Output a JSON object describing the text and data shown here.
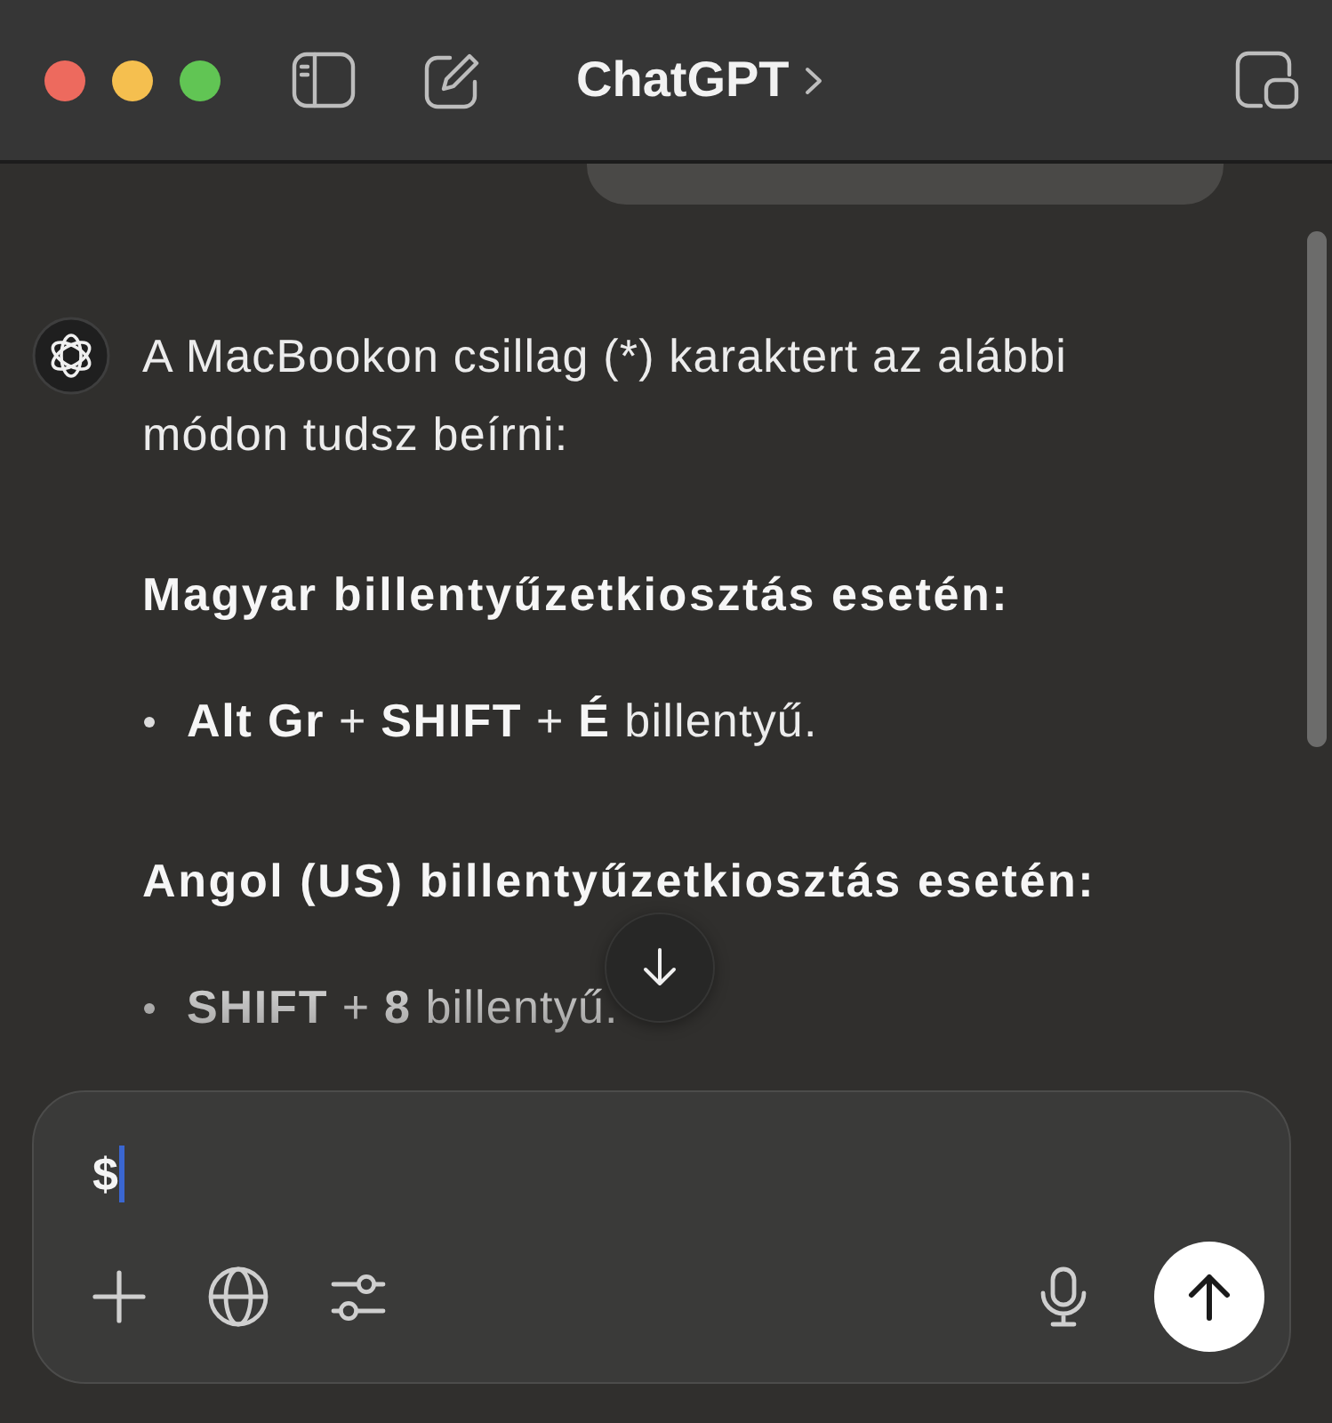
{
  "window": {
    "title": "ChatGPT"
  },
  "conversation": [
    {
      "kind": "user"
    },
    {
      "kind": "assistant",
      "blocks": [
        {
          "kind": "paragraph",
          "text": "A MacBookon csillag (*) karaktert az alábbi módon tudsz beírni:"
        },
        {
          "kind": "heading",
          "text": "Magyar billentyűzetkiosztás esetén:"
        },
        {
          "kind": "bullets",
          "items": [
            "**Alt Gr** + **SHIFT** + **É** billentyű."
          ]
        },
        {
          "kind": "heading",
          "text": "Angol (US) billentyűzetkiosztás esetén:"
        },
        {
          "kind": "bullets",
          "items": [
            "**SHIFT** + **8** billentyű."
          ]
        }
      ]
    }
  ],
  "composer": {
    "value": "$"
  }
}
